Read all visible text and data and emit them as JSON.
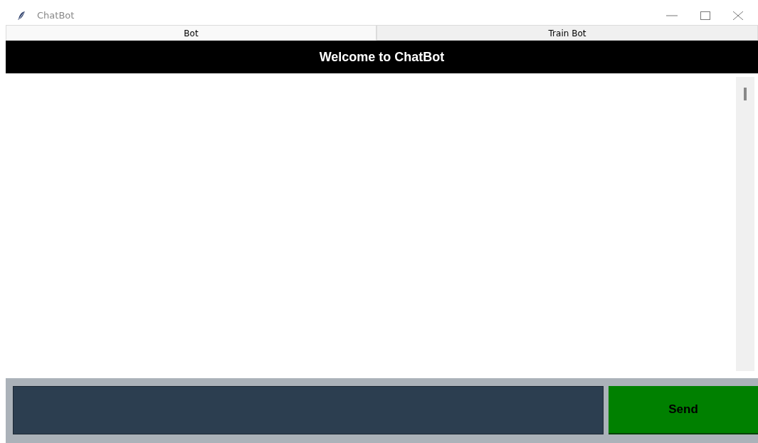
{
  "window": {
    "title": "ChatBot"
  },
  "tabs": [
    {
      "label": "Bot",
      "selected": true
    },
    {
      "label": "Train Bot",
      "selected": false
    }
  ],
  "header": {
    "title": "Welcome to ChatBot"
  },
  "composer": {
    "send_button": "Send"
  }
}
